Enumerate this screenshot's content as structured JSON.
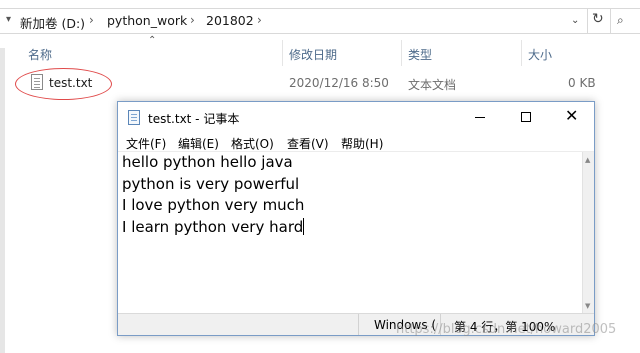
{
  "explorer": {
    "breadcrumbs": [
      "新加卷 (D:)",
      "python_work",
      "201802"
    ],
    "columns": {
      "name": "名称",
      "modified": "修改日期",
      "type": "类型",
      "size": "大小"
    },
    "files": [
      {
        "name": "test.txt",
        "modified": "2020/12/16 8:50",
        "type": "文本文档",
        "size": "0 KB"
      }
    ],
    "highlight_color": "#e04a4a"
  },
  "notepad": {
    "title": "test.txt - 记事本",
    "menu": [
      "文件(F)",
      "编辑(E)",
      "格式(O)",
      "查看(V)",
      "帮助(H)"
    ],
    "lines": [
      "hello python hello java",
      "python is very powerful",
      "I love python very much",
      "I learn python very hard"
    ],
    "status": {
      "encoding": "Windows (",
      "position": "第 4 行，第 100%"
    }
  },
  "watermark": "https://blog.csdn.net/howard2005"
}
